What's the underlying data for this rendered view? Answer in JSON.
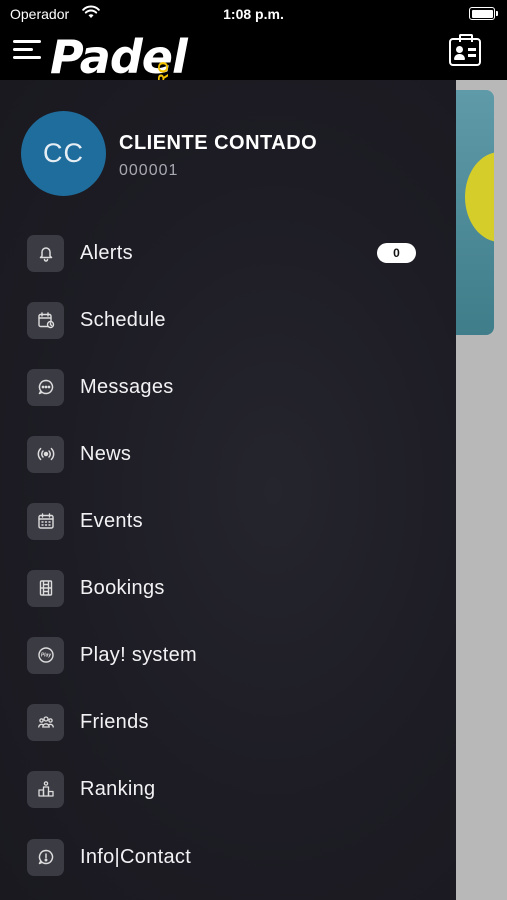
{
  "status_bar": {
    "carrier": "Operador",
    "time": "1:08 p.m."
  },
  "header": {
    "logo_main": "Padel",
    "logo_suffix": "PRO"
  },
  "user": {
    "initials": "CC",
    "name": "CLIENTE CONTADO",
    "code": "000001"
  },
  "menu": {
    "items": [
      {
        "label": "Alerts",
        "icon": "bell-icon",
        "badge": "0"
      },
      {
        "label": "Schedule",
        "icon": "schedule-icon"
      },
      {
        "label": "Messages",
        "icon": "chat-bubble-icon"
      },
      {
        "label": "News",
        "icon": "broadcast-icon"
      },
      {
        "label": "Events",
        "icon": "calendar-icon"
      },
      {
        "label": "Bookings",
        "icon": "court-icon"
      },
      {
        "label": "Play! system",
        "icon": "play-logo-icon"
      },
      {
        "label": "Friends",
        "icon": "friends-icon"
      },
      {
        "label": "Ranking",
        "icon": "podium-icon"
      },
      {
        "label": "Info|Contact",
        "icon": "info-chat-icon"
      }
    ]
  },
  "colors": {
    "drawer_bg": "#1d1c24",
    "avatar_bg": "#1f6d9d",
    "icon_tile": "#3b3b44",
    "logo_accent": "#f2c200"
  }
}
